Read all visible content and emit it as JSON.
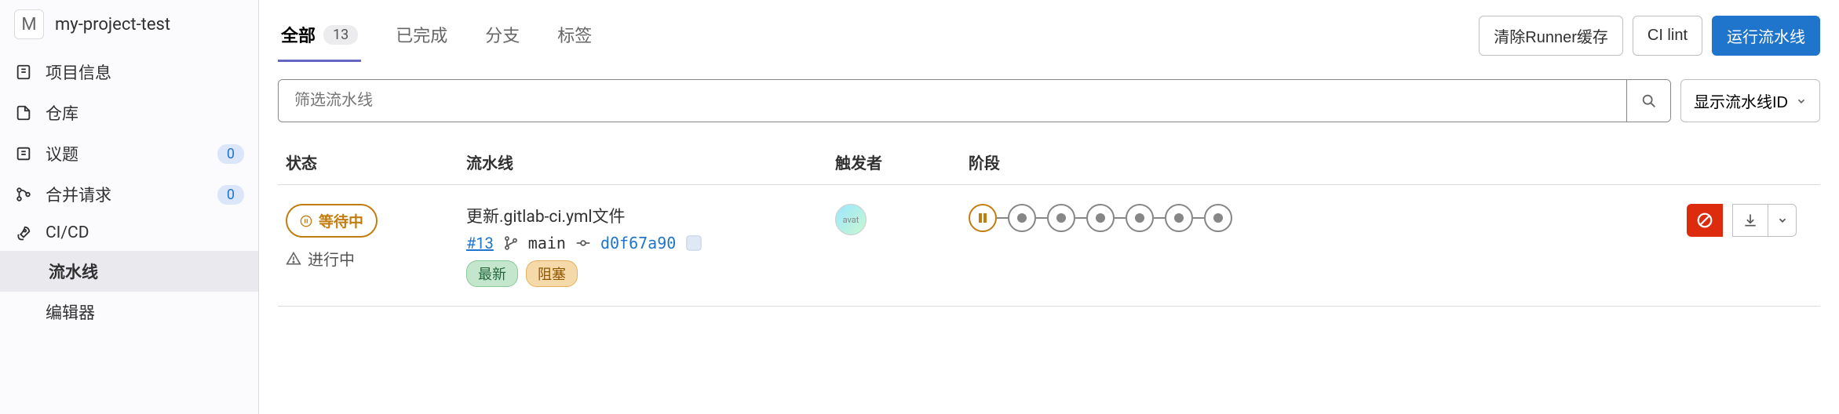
{
  "project": {
    "initial": "M",
    "name": "my-project-test"
  },
  "sidebar": {
    "items": [
      {
        "icon": "info-icon",
        "label": "项目信息"
      },
      {
        "icon": "repo-icon",
        "label": "仓库"
      },
      {
        "icon": "issues-icon",
        "label": "议题",
        "badge": "0"
      },
      {
        "icon": "merge-icon",
        "label": "合并请求",
        "badge": "0"
      },
      {
        "icon": "rocket-icon",
        "label": "CI/CD"
      }
    ],
    "subs": [
      {
        "label": "流水线",
        "active": true
      },
      {
        "label": "编辑器",
        "active": false
      }
    ]
  },
  "tabs": [
    {
      "label": "全部",
      "count": "13",
      "active": true
    },
    {
      "label": "已完成"
    },
    {
      "label": "分支"
    },
    {
      "label": "标签"
    }
  ],
  "actions": {
    "clear_cache": "清除Runner缓存",
    "ci_lint": "CI lint",
    "run_pipeline": "运行流水线"
  },
  "filter": {
    "placeholder": "筛选流水线",
    "dropdown": "显示流水线ID"
  },
  "columns": {
    "status": "状态",
    "pipeline": "流水线",
    "trigger": "触发者",
    "stages": "阶段"
  },
  "row": {
    "status_label": "等待中",
    "status_sub": "进行中",
    "title": "更新.gitlab-ci.yml文件",
    "id": "#13",
    "branch": "main",
    "commit": "d0f67a90",
    "tag_latest": "最新",
    "tag_blocked": "阻塞",
    "avatar_alt": "avat",
    "stages_count": 7
  }
}
